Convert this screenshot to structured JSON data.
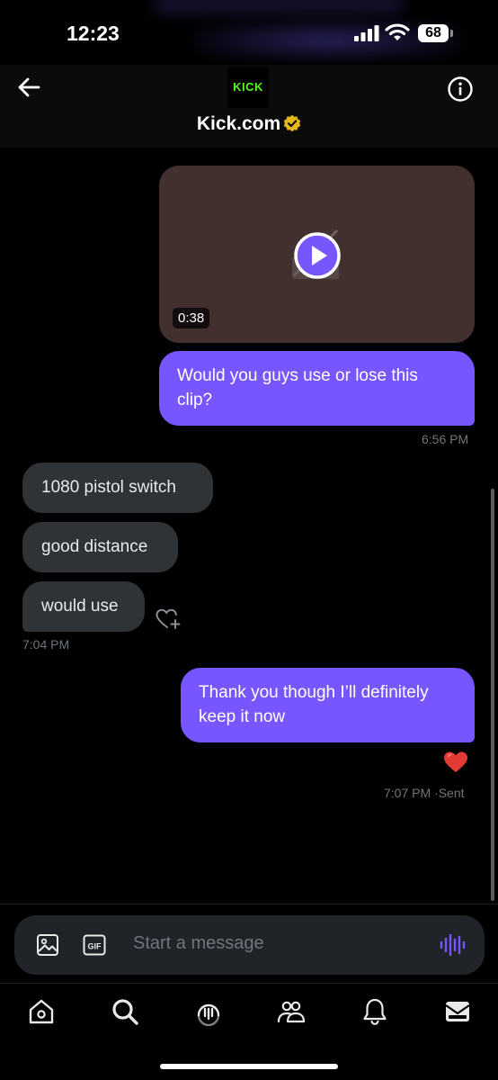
{
  "status_bar": {
    "time": "12:23",
    "battery": "68"
  },
  "header": {
    "avatar_text": "KICK",
    "title": "Kick.com"
  },
  "messages": {
    "video_duration": "0:38",
    "out_1": "Would you guys use or lose this clip?",
    "out_1_time": "6:56 PM",
    "in_1": "1080 pistol switch",
    "in_2": "good distance",
    "in_3": "would use",
    "in_time": "7:04 PM",
    "out_2": "Thank you though I’ll definitely keep it now",
    "out_2_time": "7:07 PM",
    "out_2_status": "·Sent"
  },
  "compose": {
    "placeholder": "Start a message"
  },
  "icons": {
    "back": "arrow-left-icon",
    "info": "info-icon",
    "verified": "verified-badge-icon",
    "play": "play-icon",
    "add_reaction": "heart-plus-icon",
    "reaction": "red-heart-icon",
    "media": "image-icon",
    "gif": "gif-icon",
    "voice": "voice-wave-icon",
    "nav": [
      "home-icon",
      "search-icon",
      "grok-icon",
      "communities-icon",
      "notifications-icon",
      "messages-icon"
    ]
  },
  "colors": {
    "accent": "#7856ff",
    "incoming_bubble": "#2f3336",
    "kick_green": "#53fc18",
    "verified_gold": "#e2b719"
  }
}
